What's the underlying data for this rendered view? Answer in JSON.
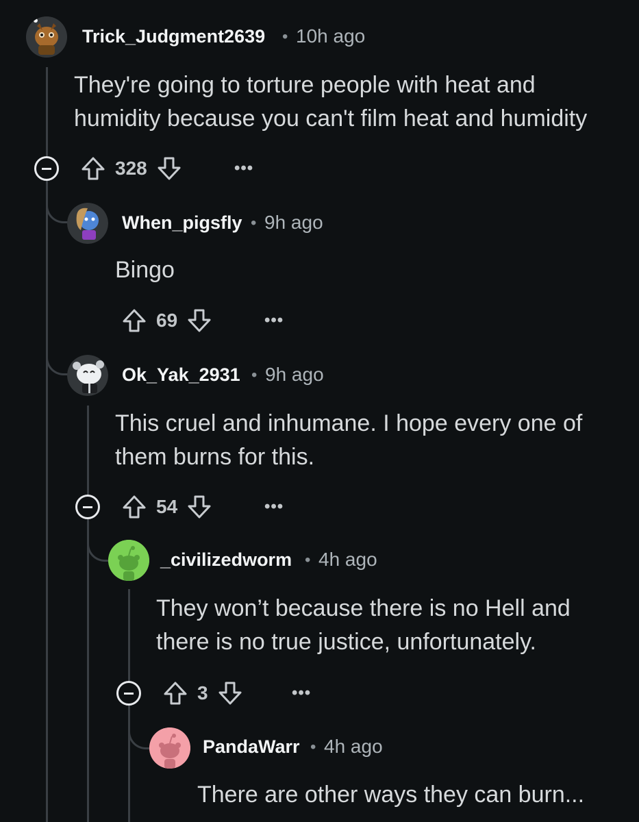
{
  "comments": [
    {
      "username": "Trick_Judgment2639",
      "separator": "•",
      "time": "10h ago",
      "body": "They're going to torture people with heat and\nhumidity because you can't film heat and humidity",
      "votes": "328",
      "more": "•••"
    },
    {
      "username": "When_pigsfly",
      "separator": "•",
      "time": "9h ago",
      "body": "Bingo",
      "votes": "69",
      "more": "•••"
    },
    {
      "username": "Ok_Yak_2931",
      "separator": "•",
      "time": "9h ago",
      "body": "This cruel and inhumane. I hope every one of\nthem burns for this.",
      "votes": "54",
      "more": "•••"
    },
    {
      "username": "_civilizedworm",
      "separator": "•",
      "time": "4h ago",
      "body": "They won’t because there is no Hell and\nthere is no true justice, unfortunately.",
      "votes": "3",
      "more": "•••"
    },
    {
      "username": "PandaWarr",
      "separator": "•",
      "time": "4h ago",
      "body": "There are other ways they can burn..."
    }
  ],
  "colors": {
    "background": "#0e1113",
    "thread_line": "#3a3f44",
    "avatar_green": "#7bd154",
    "avatar_pink": "#f4a0a8"
  }
}
